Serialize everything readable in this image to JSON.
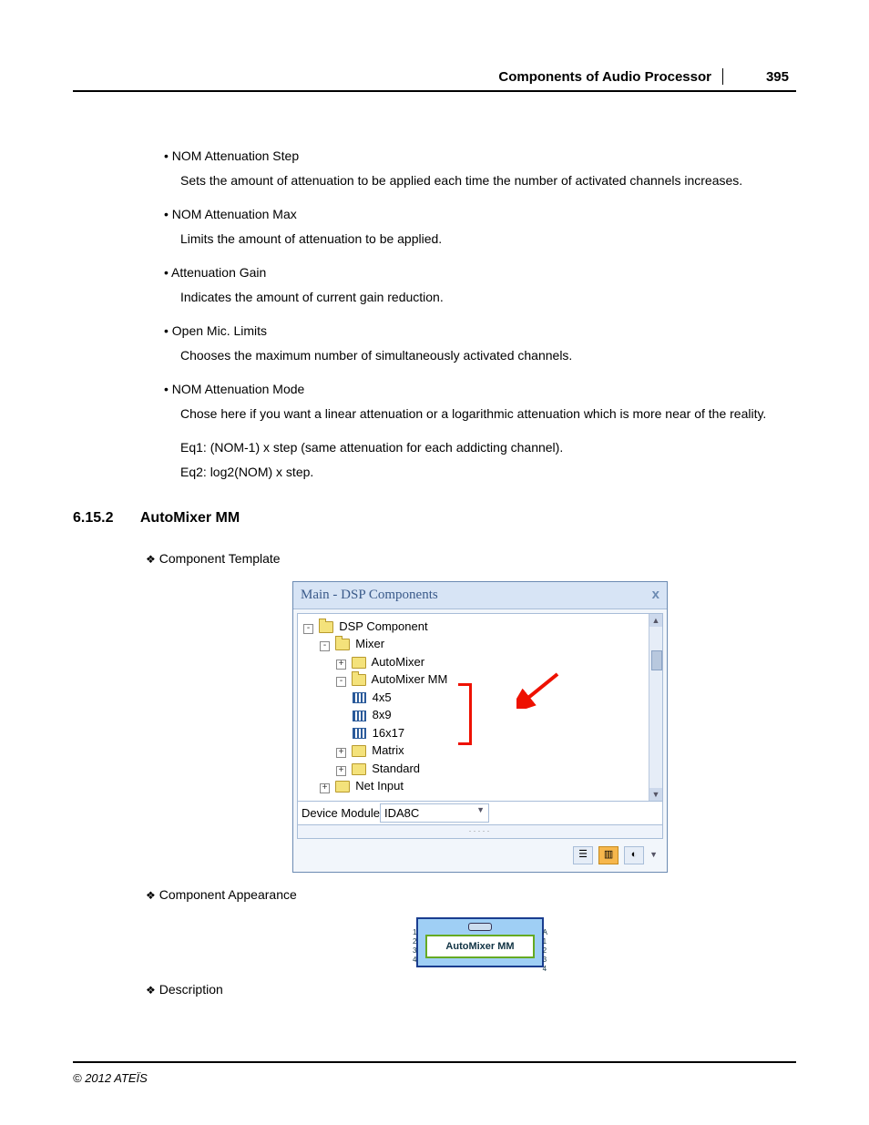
{
  "header": {
    "title": "Components of Audio Processor",
    "page": "395"
  },
  "bullets": [
    {
      "label": "NOM Attenuation Step",
      "desc": "Sets the amount of attenuation to be applied each time the number of activated channels increases."
    },
    {
      "label": "NOM Attenuation Max",
      "desc": "Limits the amount of attenuation to be applied."
    },
    {
      "label": "Attenuation Gain",
      "desc": "Indicates the amount of current gain reduction."
    },
    {
      "label": "Open Mic. Limits",
      "desc": "Chooses the maximum number of simultaneously activated channels."
    },
    {
      "label": "NOM Attenuation Mode",
      "desc": "Chose here if you want a linear attenuation or a logarithmic attenuation which is more near of the reality.",
      "eq1": "Eq1: (NOM-1) x step (same attenuation for each addicting channel).",
      "eq2": "Eq2: log2(NOM) x step."
    }
  ],
  "section": {
    "number": "6.15.2",
    "title": "AutoMixer MM"
  },
  "diamond1": "Component Template",
  "diamond2": "Component Appearance",
  "diamond3": "Description",
  "panel": {
    "title": "Main - DSP Components",
    "tree": {
      "root": "DSP Component",
      "mixer": "Mixer",
      "automixer": "AutoMixer",
      "automixer_mm": "AutoMixer MM",
      "mm1": "4x5",
      "mm2": "8x9",
      "mm3": "16x17",
      "matrix": "Matrix",
      "standard": "Standard",
      "netinput": "Net Input"
    },
    "device_label": "Device Module",
    "device_value": "IDA8C"
  },
  "component_block": {
    "title": "AutoMixer MM",
    "ports_in": [
      "1",
      "2",
      "3",
      "4"
    ],
    "ports_out_label": "A",
    "ports_out": [
      "1",
      "2",
      "3",
      "4"
    ]
  },
  "footer": "© 2012 ATEÏS"
}
